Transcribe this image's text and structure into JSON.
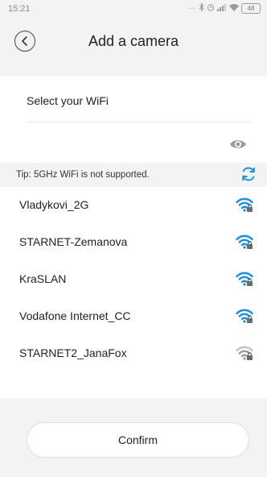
{
  "status_bar": {
    "time": "15:21",
    "battery": "48"
  },
  "header": {
    "title": "Add a camera"
  },
  "wifi_form": {
    "ssid_label": "Select your WiFi",
    "password_value": ""
  },
  "tip": {
    "text": "Tip: 5GHz WiFi is not supported."
  },
  "networks": [
    {
      "name": "Vladykovi_2G",
      "signal": "strong",
      "locked": true
    },
    {
      "name": "STARNET-Zemanova",
      "signal": "strong",
      "locked": true
    },
    {
      "name": "KraSLAN",
      "signal": "strong",
      "locked": true
    },
    {
      "name": "Vodafone Internet_CC",
      "signal": "strong",
      "locked": true
    },
    {
      "name": "STARNET2_JanaFox",
      "signal": "weak",
      "locked": true
    }
  ],
  "confirm": {
    "label": "Confirm"
  },
  "colors": {
    "accent": "#1a8ee0",
    "weak_signal": "#b0b0b0",
    "background": "#f3f3f3"
  },
  "icons": {
    "back": "chevron-left-icon",
    "password_toggle": "eye-icon",
    "refresh": "refresh-icon",
    "wifi": "wifi-lock-icon"
  }
}
